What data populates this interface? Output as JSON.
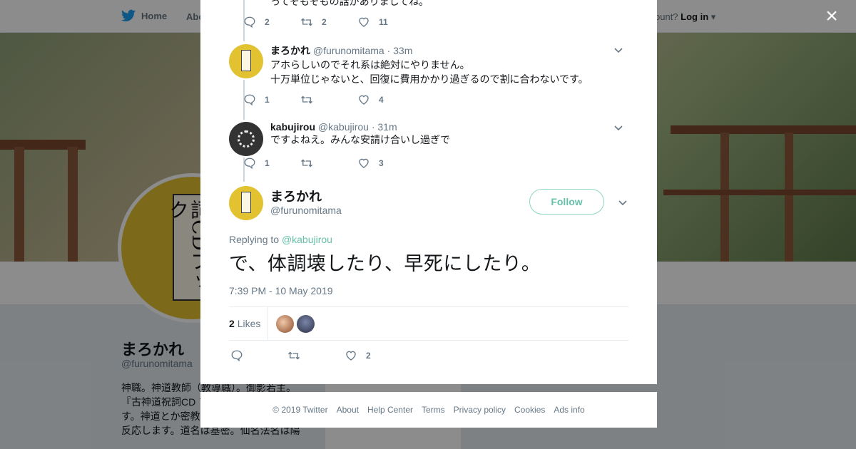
{
  "background": {
    "nav": {
      "home": "Home",
      "about": "Abo",
      "login_prefix": "ccount?",
      "login": "Log in"
    },
    "profile": {
      "avatar_text": "古神道祝詞CDブック",
      "name": "まろかれ",
      "handle": "@furunomitama",
      "bio": "神職。神道教師（教導職）。御影若主。『古神道祝詞CD ブ で買えます。祝詞 す。神道とか密教とか陰陽道とか仙道に反応します。道名は基密。仙名法名は陽"
    }
  },
  "modal": {
    "close": "×",
    "top_partial": {
      "text": "ってそもそもの話がありましてね。",
      "replies": "2",
      "retweets": "2",
      "likes": "11"
    },
    "replies": [
      {
        "name": "まろかれ",
        "handle": "@furunomitama",
        "time": "· 33m",
        "line1": "アホらしいのでそれ系は絶対にやりません。",
        "line2": "十万単位じゃないと、回復に費用かかり過ぎるので割に合わないです。",
        "replies": "1",
        "retweets": "",
        "likes": "4"
      },
      {
        "name": "kabujirou",
        "handle": "@kabujirou",
        "time": "· 31m",
        "line1": "ですよねえ。みんな安請け合いし過ぎで",
        "replies": "1",
        "retweets": "",
        "likes": "3"
      }
    ],
    "main": {
      "name": "まろかれ",
      "handle": "@furunomitama",
      "follow": "Follow",
      "replying_to": "Replying to",
      "replying_handle": "@kabujirou",
      "text": "で、体調壊したり、早死にしたり。",
      "timestamp": "7:39 PM - 10 May 2019",
      "like_count": "2",
      "likes_label": "Likes",
      "replies": "",
      "retweets": "",
      "likes": "2"
    }
  },
  "footer": [
    "© 2019 Twitter",
    "About",
    "Help Center",
    "Terms",
    "Privacy policy",
    "Cookies",
    "Ads info"
  ],
  "colors": {
    "accent": "#66c1a8",
    "follow_border": "#8ed6c4",
    "muted": "#657786"
  }
}
